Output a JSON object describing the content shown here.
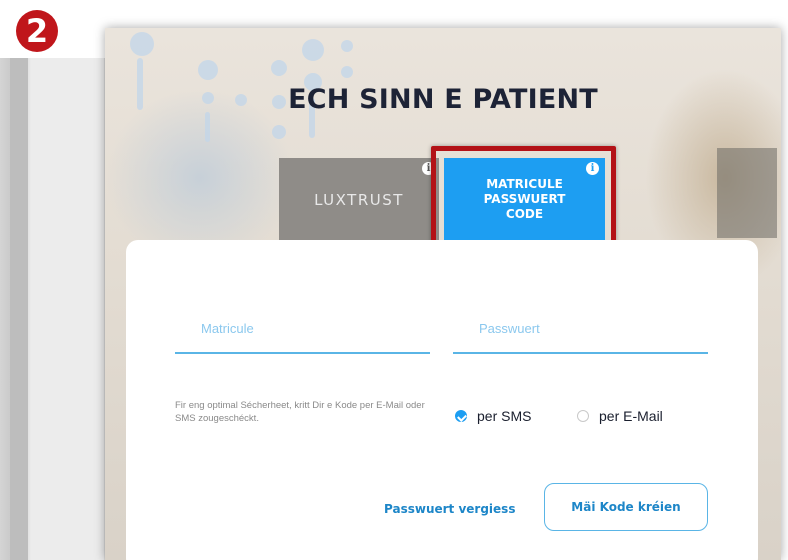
{
  "step_badge": "2",
  "title": "ECH SINN E PATIENT",
  "tabs": {
    "luxtrust": {
      "label": "LUXTRUST"
    },
    "matricule": {
      "lines": [
        "MATRICULE",
        "PASSWUERT",
        "CODE"
      ]
    }
  },
  "info_icon_glyph": "i",
  "form": {
    "matricule_placeholder": "Matricule",
    "password_placeholder": "Passwuert",
    "hint": "Fir eng optimal Sécherheet, kritt Dir e Kode per E-Mail oder SMS zougeschéckt.",
    "radio_sms": "per SMS",
    "radio_email": "per E-Mail",
    "selected_channel": "sms",
    "forgot_link": "Passwuert vergiess",
    "create_button": "Mäi Kode kréien"
  },
  "colors": {
    "accent": "#1d9ef2",
    "highlight_red": "#b31217",
    "title": "#1d2336"
  }
}
